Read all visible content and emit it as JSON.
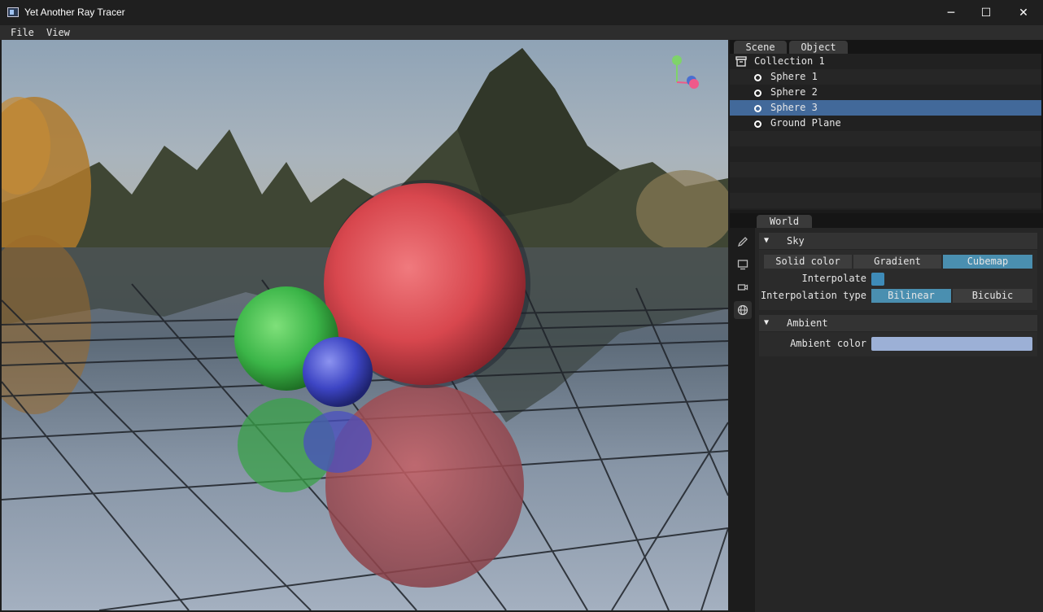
{
  "window": {
    "title": "Yet Another Ray Tracer",
    "minimize": "─",
    "maximize": "☐",
    "close": "✕"
  },
  "menu": [
    "File",
    "View"
  ],
  "colors": {
    "selection": "#42699a",
    "toggle_on": "#4a8fb0",
    "ambient_swatch": "#9cb0d6"
  },
  "outliner": {
    "tabs": [
      "Scene",
      "Object"
    ],
    "collection": "Collection 1",
    "items": [
      {
        "label": "Sphere 1",
        "selected": false
      },
      {
        "label": "Sphere 2",
        "selected": false
      },
      {
        "label": "Sphere 3",
        "selected": true
      },
      {
        "label": "Ground Plane",
        "selected": false
      }
    ]
  },
  "properties": {
    "tab": "World",
    "sidebar_icons": [
      "pencil-icon",
      "monitor-icon",
      "camera-icon",
      "globe-icon"
    ],
    "sky": {
      "header": "Sky",
      "modes": [
        "Solid color",
        "Gradient",
        "Cubemap"
      ],
      "selected_mode": "Cubemap",
      "interpolate_label": "Interpolate",
      "interpolate_checked": true,
      "interpolation_type_label": "Interpolation type",
      "interpolation_types": [
        "Bilinear",
        "Bicubic"
      ],
      "selected_interpolation": "Bilinear"
    },
    "ambient": {
      "header": "Ambient",
      "color_label": "Ambient color",
      "color": "#9cb0d6"
    }
  }
}
